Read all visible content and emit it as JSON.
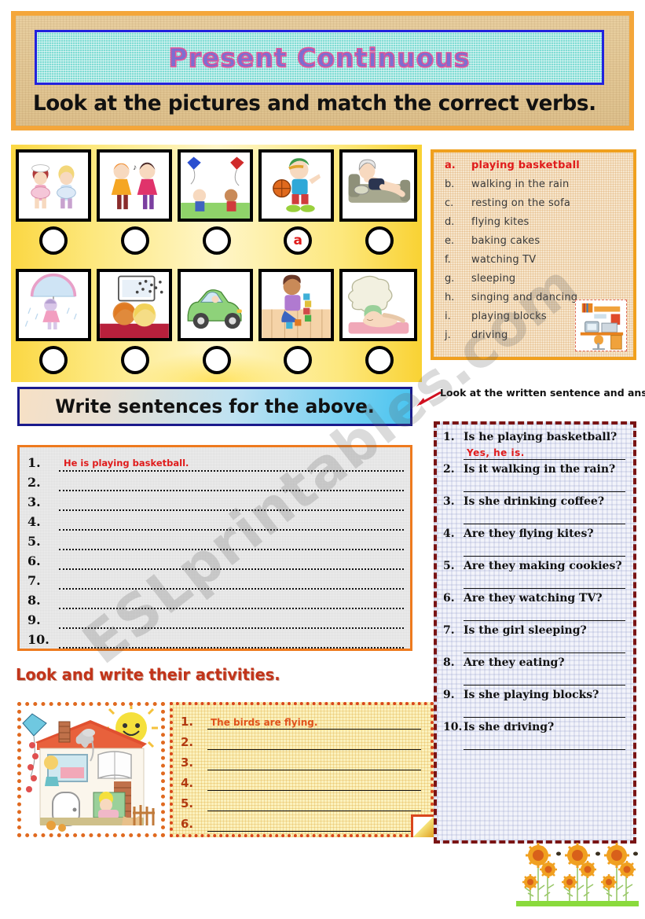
{
  "header": {
    "title": "Present Continuous",
    "instruction": "Look at the pictures and match the correct verbs."
  },
  "matching": {
    "row1": [
      {
        "picture": "two-girls-baking-cakes",
        "answer": ""
      },
      {
        "picture": "two-girls-singing-and-dancing",
        "answer": ""
      },
      {
        "picture": "two-boys-flying-kites",
        "answer": ""
      },
      {
        "picture": "boy-playing-basketball",
        "answer": "a"
      },
      {
        "picture": "woman-resting-on-sofa",
        "answer": ""
      }
    ],
    "row2": [
      {
        "picture": "girl-walking-in-the-rain-with-umbrella",
        "answer": ""
      },
      {
        "picture": "children-watching-tv",
        "answer": ""
      },
      {
        "picture": "person-driving-green-car",
        "answer": ""
      },
      {
        "picture": "girl-playing-blocks",
        "answer": ""
      },
      {
        "picture": "girl-sleeping-with-dream-cloud",
        "answer": ""
      }
    ]
  },
  "verbs": {
    "items": [
      {
        "letter": "a.",
        "text": "playing basketball"
      },
      {
        "letter": "b.",
        "text": "walking in the rain"
      },
      {
        "letter": "c.",
        "text": "resting on the sofa"
      },
      {
        "letter": "d.",
        "text": "flying kites"
      },
      {
        "letter": "e.",
        "text": "baking cakes"
      },
      {
        "letter": "f.",
        "text": "watching TV"
      },
      {
        "letter": "g.",
        "text": "sleeping"
      },
      {
        "letter": "h.",
        "text": "singing and dancing"
      },
      {
        "letter": "i.",
        "text": "playing blocks"
      },
      {
        "letter": "j.",
        "text": "driving"
      }
    ],
    "clipart": "computer-desk-picture"
  },
  "write_section": {
    "banner": "Write sentences for the above.",
    "lines": [
      {
        "num": "1.",
        "answer": "He is playing basketball."
      },
      {
        "num": "2.",
        "answer": ""
      },
      {
        "num": "3.",
        "answer": ""
      },
      {
        "num": "4.",
        "answer": ""
      },
      {
        "num": "5.",
        "answer": ""
      },
      {
        "num": "6.",
        "answer": ""
      },
      {
        "num": "7.",
        "answer": ""
      },
      {
        "num": "8.",
        "answer": ""
      },
      {
        "num": "9.",
        "answer": ""
      },
      {
        "num": "10.",
        "answer": ""
      }
    ]
  },
  "questions_section": {
    "note": "Look at the written sentence and answer.",
    "items": [
      {
        "num": "1.",
        "question": "Is he playing basketball?",
        "answer": "Yes, he is."
      },
      {
        "num": "2.",
        "question": "Is it walking in the rain?",
        "answer": ""
      },
      {
        "num": "3.",
        "question": "Is she drinking coffee?",
        "answer": ""
      },
      {
        "num": "4.",
        "question": "Are they flying kites?",
        "answer": ""
      },
      {
        "num": "5.",
        "question": "Are they making cookies?",
        "answer": ""
      },
      {
        "num": "6.",
        "question": "Are they watching TV?",
        "answer": ""
      },
      {
        "num": "7.",
        "question": "Is the girl sleeping?",
        "answer": ""
      },
      {
        "num": "8.",
        "question": "Are they eating?",
        "answer": ""
      },
      {
        "num": "9.",
        "question": "Is she playing blocks?",
        "answer": ""
      },
      {
        "num": "10.",
        "question": "Is she driving?",
        "answer": ""
      }
    ]
  },
  "activities_section": {
    "heading": "Look and write their activities.",
    "picture": "cutaway-house-with-sun-cat-kite-and-family",
    "lines": [
      {
        "num": "1.",
        "answer": "The birds are flying."
      },
      {
        "num": "2.",
        "answer": ""
      },
      {
        "num": "3.",
        "answer": ""
      },
      {
        "num": "4.",
        "answer": ""
      },
      {
        "num": "5.",
        "answer": ""
      },
      {
        "num": "6.",
        "answer": ""
      }
    ]
  },
  "footer": {
    "decoration": "sunflowers-with-bees"
  },
  "watermark": {
    "text": "ESLprintables.com"
  },
  "colors": {
    "header_border": "#f4a63a",
    "title_bar": "#80dcd4",
    "title_accent": "#e0559a",
    "answer_red": "#e01b1b",
    "orange_panel": "#ee7a1e",
    "dark_red_dash": "#7a1414",
    "heading_red": "#c2341a",
    "yellow_band": "#fbd743"
  }
}
